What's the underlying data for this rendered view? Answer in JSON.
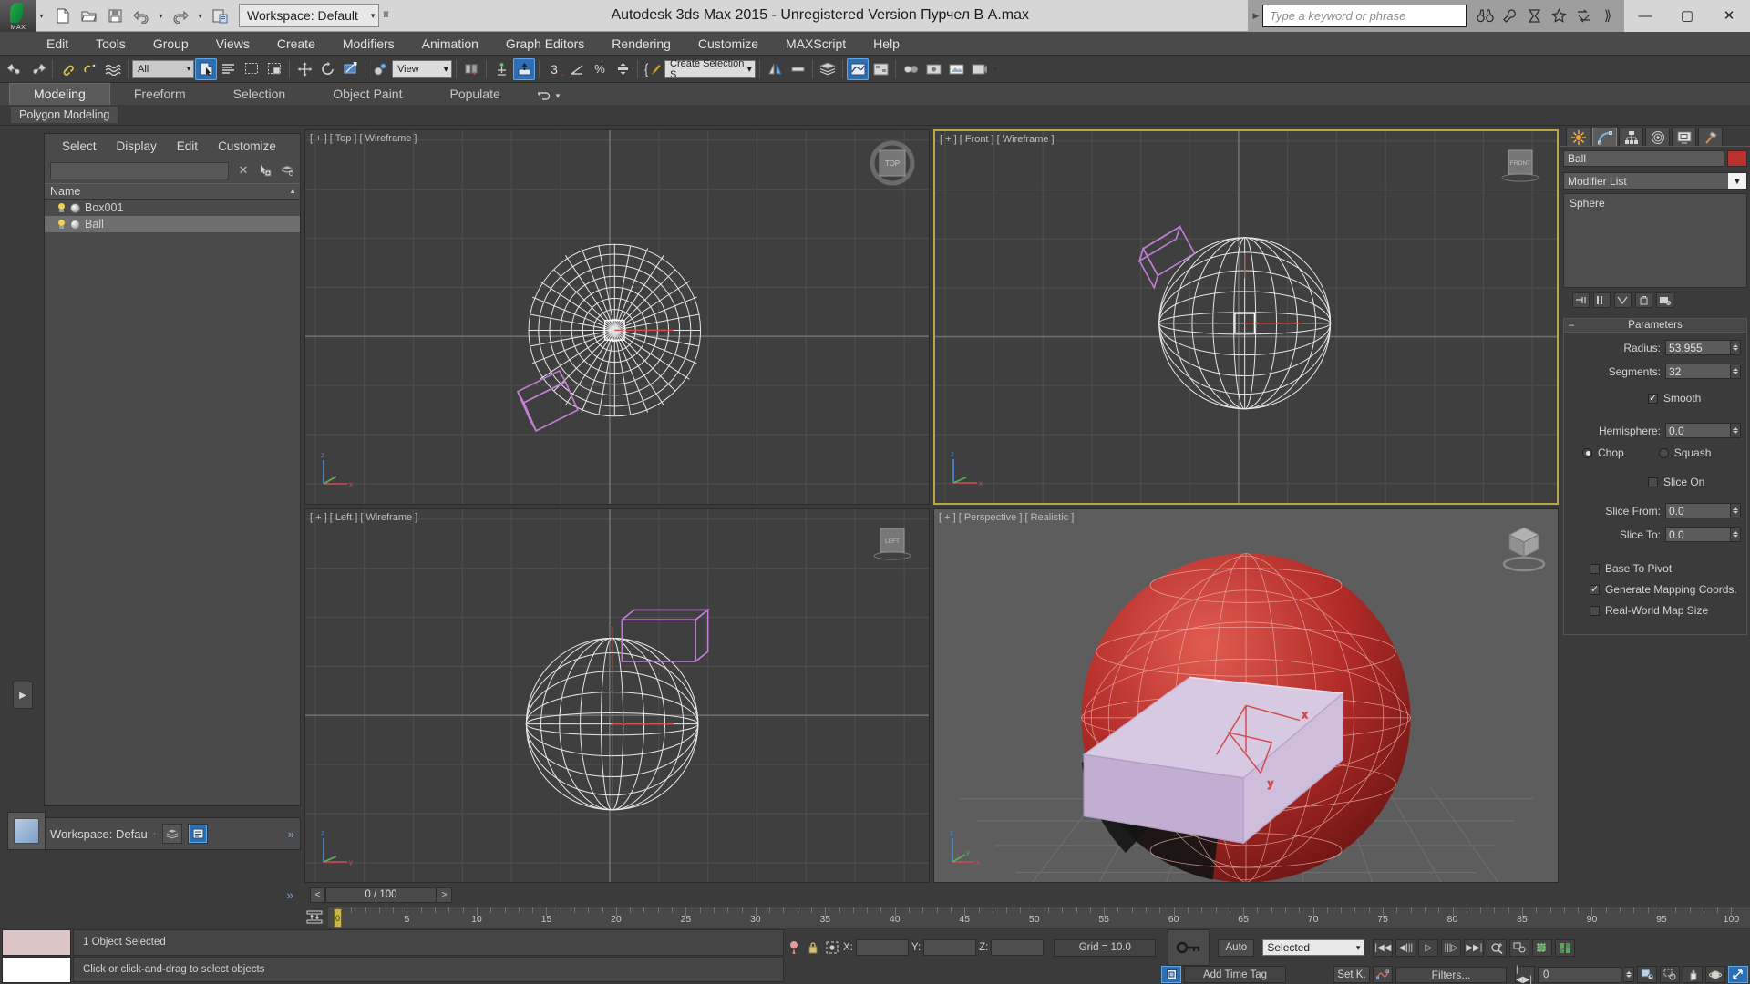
{
  "titlebar": {
    "logo_caption": "MAX",
    "workspace_label": "Workspace: Default",
    "app_title": "Autodesk 3ds Max  2015  - Unregistered Version   Пурчел В A.max",
    "search_placeholder": "Type a keyword or phrase",
    "quick_access": [
      {
        "name": "new-file-icon",
        "label": "New"
      },
      {
        "name": "open-file-icon",
        "label": "Open"
      },
      {
        "name": "save-file-icon",
        "label": "Save"
      },
      {
        "name": "undo-icon",
        "label": "Undo"
      },
      {
        "name": "redo-icon",
        "label": "Redo"
      },
      {
        "name": "project-folder-icon",
        "label": "Set Project Folder"
      }
    ],
    "info_icons": [
      "binoculars-icon",
      "wrench-icon",
      "autodesk-a360-icon",
      "star-icon",
      "exchange-icon",
      "chevrons-right-icon"
    ],
    "window_buttons": [
      "minimize",
      "maximize",
      "close"
    ]
  },
  "menubar": {
    "items": [
      "Edit",
      "Tools",
      "Group",
      "Views",
      "Create",
      "Modifiers",
      "Animation",
      "Graph Editors",
      "Rendering",
      "Customize",
      "MAXScript",
      "Help"
    ]
  },
  "toolbar": {
    "selection_filter": "All",
    "reference_coord": "View",
    "named_selection_sets": "Create Selection S",
    "items": [
      "undo-icon",
      "redo-icon",
      "select-link-icon",
      "unlink-icon",
      "bind-spacewarp-icon",
      "select-object-icon",
      "select-by-name-icon",
      "rect-region-icon",
      "window-crossing-icon",
      "select-move-icon",
      "select-rotate-icon",
      "select-scale-icon",
      "use-center-icon",
      "percent-snap-icon",
      "angle-snap-icon",
      "spinner-snap-icon",
      "snaps-toggle-icon",
      "edit-named-selections-icon",
      "mirror-icon",
      "align-icon",
      "layer-manager-icon",
      "graph-editor-icon",
      "schematic-view-icon",
      "material-editor-icon",
      "render-setup-icon",
      "rendered-frame-icon",
      "render-production-icon"
    ]
  },
  "ribbon": {
    "tabs": [
      "Modeling",
      "Freeform",
      "Selection",
      "Object Paint",
      "Populate"
    ],
    "active_tab": "Modeling",
    "subtab": "Polygon Modeling"
  },
  "scene_explorer": {
    "menu": [
      "Select",
      "Display",
      "Edit",
      "Customize"
    ],
    "search_value": "",
    "column_header": "Name",
    "objects": [
      {
        "name": "Box001",
        "selected": false,
        "visible": true
      },
      {
        "name": "Ball",
        "selected": true,
        "visible": true
      }
    ],
    "workspace_footer": "Workspace: Defau"
  },
  "viewports": [
    {
      "label": "[ + ] [ Top ] [ Wireframe ]",
      "cube_label": "TOP",
      "active": false,
      "shading": "wireframe"
    },
    {
      "label": "[ + ] [ Front ] [ Wireframe ]",
      "cube_label": "FRONT",
      "active": true,
      "shading": "wireframe"
    },
    {
      "label": "[ + ] [ Left ] [ Wireframe ]",
      "cube_label": "LEFT",
      "active": false,
      "shading": "wireframe"
    },
    {
      "label": "[ + ] [ Perspective ] [ Realistic ]",
      "cube_label": "",
      "active": false,
      "shading": "realistic"
    }
  ],
  "command_panel": {
    "tabs": [
      {
        "name": "create-tab",
        "icon": "star-burst-icon",
        "active": false
      },
      {
        "name": "modify-tab",
        "icon": "curve-icon",
        "active": true
      },
      {
        "name": "hierarchy-tab",
        "icon": "hierarchy-icon",
        "active": false
      },
      {
        "name": "motion-tab",
        "icon": "motion-icon",
        "active": false
      },
      {
        "name": "display-tab",
        "icon": "display-icon",
        "active": false
      },
      {
        "name": "utilities-tab",
        "icon": "hammer-icon",
        "active": false
      }
    ],
    "object_name": "Ball",
    "object_color": "#b9322f",
    "modifier_list_label": "Modifier List",
    "stack": [
      "Sphere"
    ],
    "parameters": {
      "rollout_title": "Parameters",
      "radius_label": "Radius:",
      "radius_value": "53.955",
      "segments_label": "Segments:",
      "segments_value": "32",
      "smooth_label": "Smooth",
      "smooth_checked": true,
      "hemisphere_label": "Hemisphere:",
      "hemisphere_value": "0.0",
      "chop_label": "Chop",
      "chop_selected": true,
      "squash_label": "Squash",
      "squash_selected": false,
      "slice_on_label": "Slice On",
      "slice_on_checked": false,
      "slice_from_label": "Slice From:",
      "slice_from_value": "0.0",
      "slice_to_label": "Slice To:",
      "slice_to_value": "0.0",
      "base_to_pivot_label": "Base To Pivot",
      "base_to_pivot_checked": false,
      "generate_mapping_label": "Generate Mapping Coords.",
      "generate_mapping_checked": true,
      "real_world_label": "Real-World Map Size",
      "real_world_checked": false
    }
  },
  "timeline": {
    "frame_readout": "0 / 100",
    "prev_label": "<",
    "next_label": ">",
    "current_frame": 0,
    "ruler_ticks": [
      0,
      5,
      10,
      15,
      20,
      25,
      30,
      35,
      40,
      45,
      50,
      55,
      60,
      65,
      70,
      75,
      80,
      85,
      90,
      95,
      100
    ],
    "range_start": 0,
    "range_end": 100
  },
  "statusbar": {
    "selection_status": "1 Object Selected",
    "prompt": "Click or click-and-drag to select objects",
    "x_label": "X:",
    "x_value": "",
    "y_label": "Y:",
    "y_value": "",
    "z_label": "Z:",
    "z_value": "",
    "grid_text": "Grid = 10.0",
    "add_time_tag": "Add Time Tag",
    "auto_key": "Auto",
    "set_key": "Set K.",
    "key_filter_mode": "Selected",
    "filters_label": "Filters...",
    "current_frame_field": "0",
    "playback_buttons": [
      "go-to-start-icon",
      "previous-frame-icon",
      "play-animation-icon",
      "next-frame-icon",
      "go-to-end-icon"
    ],
    "nav_buttons": [
      "zoom-icon",
      "zoom-all-icon",
      "zoom-extents-icon",
      "zoom-extents-all-icon",
      "field-of-view-icon",
      "region-zoom-icon",
      "pan-view-icon",
      "orbit-icon",
      "maximize-viewport-icon"
    ]
  }
}
